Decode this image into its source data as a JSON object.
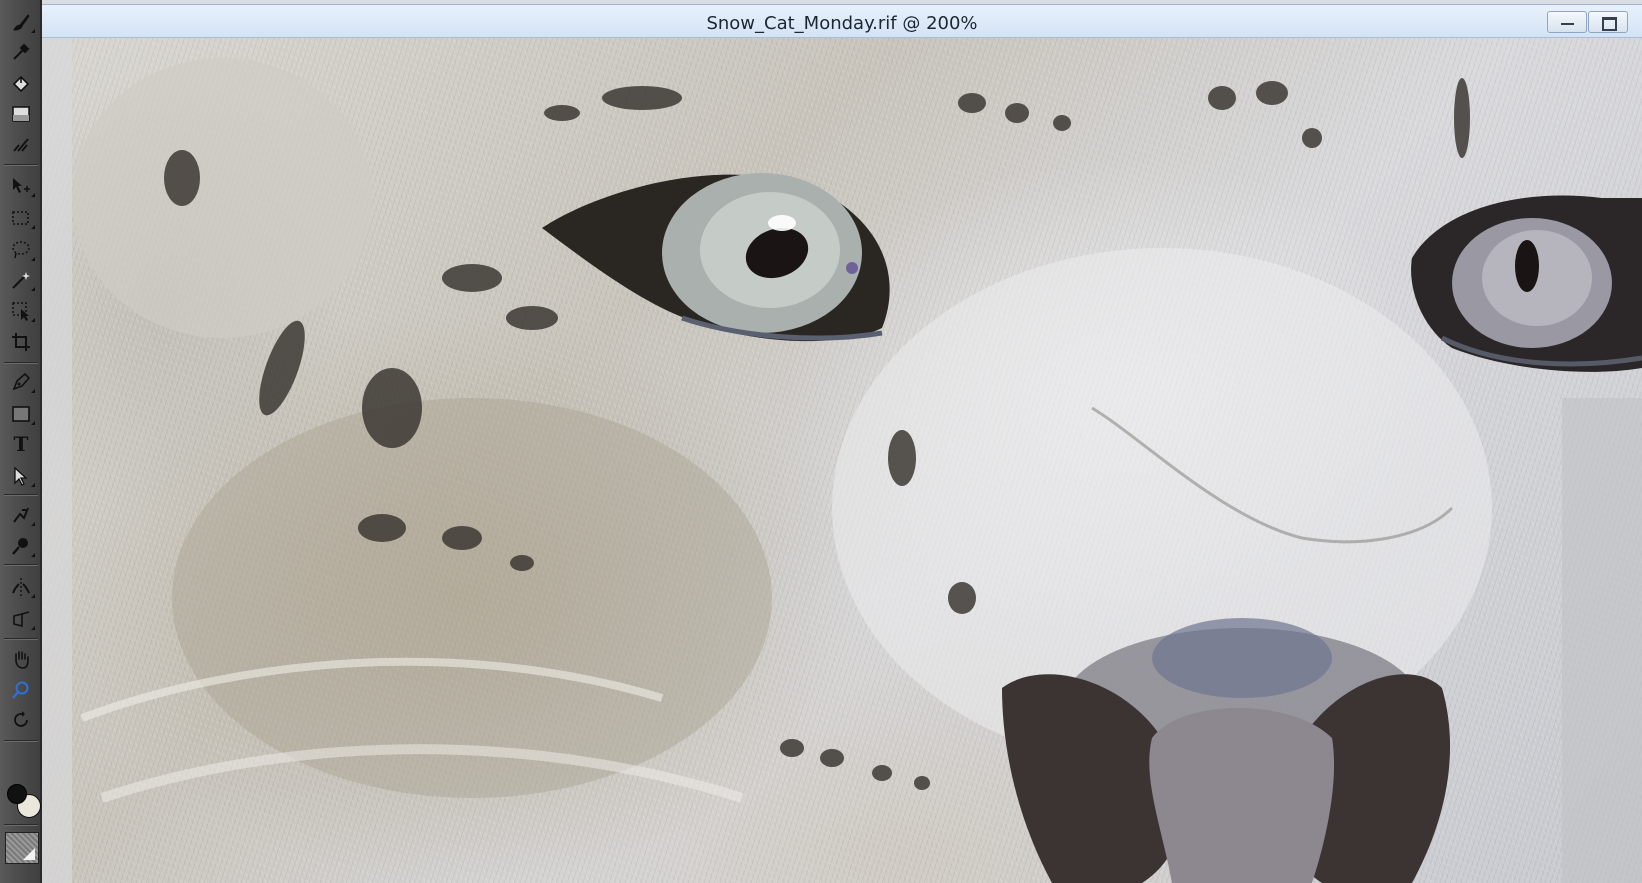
{
  "window": {
    "title": "Snow_Cat_Monday.rif @ 200%"
  },
  "toolbox": {
    "tools": [
      {
        "id": "brush",
        "icon": "brush-icon"
      },
      {
        "id": "dropper",
        "icon": "dropper-icon"
      },
      {
        "id": "paint-bucket",
        "icon": "paint-bucket-icon"
      },
      {
        "id": "eraser",
        "icon": "eraser-icon"
      },
      {
        "id": "blender",
        "icon": "blender-icon"
      },
      {
        "id": "layer-adjuster",
        "icon": "layer-adjuster-icon"
      },
      {
        "id": "rectangular-selection",
        "icon": "rectangular-selection-icon"
      },
      {
        "id": "lasso",
        "icon": "lasso-icon"
      },
      {
        "id": "magic-wand",
        "icon": "magic-wand-icon"
      },
      {
        "id": "selection-adjuster",
        "icon": "selection-adjuster-icon"
      },
      {
        "id": "crop",
        "icon": "crop-icon"
      },
      {
        "id": "pen",
        "icon": "pen-icon"
      },
      {
        "id": "rectangle-shape",
        "icon": "rectangle-shape-icon"
      },
      {
        "id": "text",
        "icon": "text-icon",
        "glyph": "T"
      },
      {
        "id": "shape-selection",
        "icon": "shape-selection-icon"
      },
      {
        "id": "cloner",
        "icon": "cloner-icon"
      },
      {
        "id": "dodge",
        "icon": "dodge-icon"
      },
      {
        "id": "mirror-painting",
        "icon": "mirror-painting-icon"
      },
      {
        "id": "perspective-guides",
        "icon": "perspective-guides-icon"
      },
      {
        "id": "grabber",
        "icon": "hand-icon"
      },
      {
        "id": "magnifier",
        "icon": "magnifier-icon",
        "active": true
      },
      {
        "id": "rotate-page",
        "icon": "rotate-page-icon"
      }
    ],
    "main_color": "#111111",
    "additional_color": "#ece7dd"
  },
  "colors": {
    "toolbox_bg": "#4b4b4b",
    "titlebar_bg": "#d3e3f5",
    "active_tool": "#2f6fd6"
  }
}
